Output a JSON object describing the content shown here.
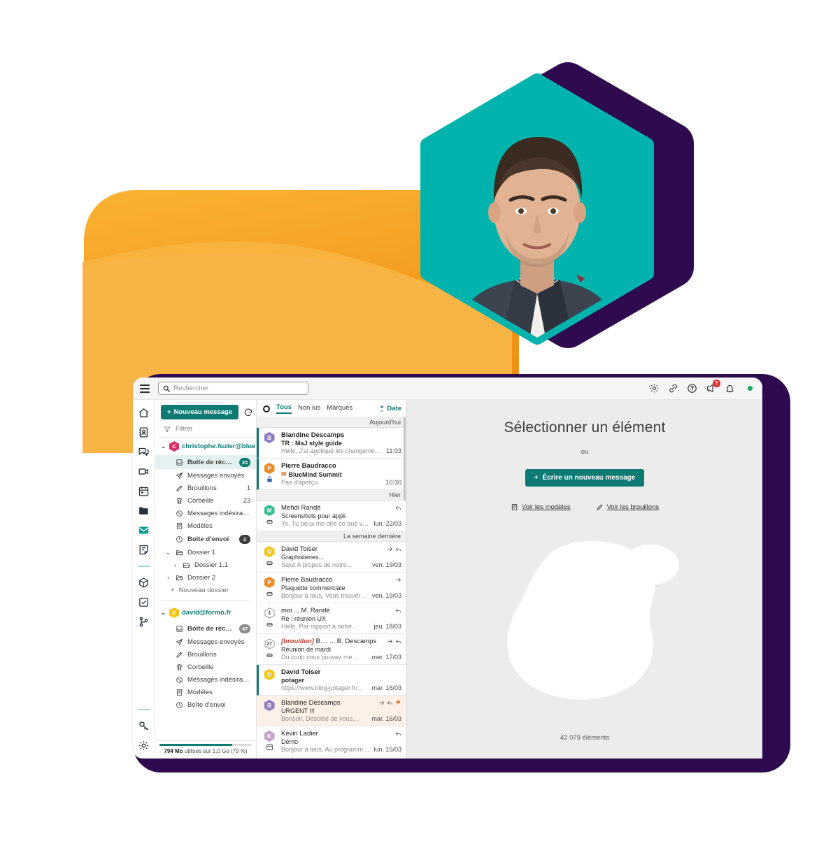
{
  "window": {
    "search": {
      "placeholder": "Rechercher",
      "value": "",
      "icon": "search-icon"
    },
    "menu_icon": "hamburger-icon",
    "topbar_icons": [
      {
        "name": "gear-icon",
        "label": "Paramètres"
      },
      {
        "name": "link-icon",
        "label": "Liens"
      },
      {
        "name": "help-icon",
        "label": "Aide"
      },
      {
        "name": "announcement-icon",
        "label": "Annonces",
        "badge": "3"
      },
      {
        "name": "bell-icon",
        "label": "Notifications"
      }
    ],
    "status_dot_color": "#18a566"
  },
  "rail": {
    "items": [
      {
        "name": "home-icon",
        "label": "Accueil",
        "active": false
      },
      {
        "name": "contacts-icon",
        "label": "Contacts",
        "active": false
      },
      {
        "name": "chat-icon",
        "label": "Messagerie instantanée",
        "active": false
      },
      {
        "name": "video-icon",
        "label": "Visioconférence",
        "active": false
      },
      {
        "name": "calendar-icon",
        "label": "Agenda",
        "active": false
      },
      {
        "name": "folder-icon",
        "label": "Fichiers",
        "active": false
      },
      {
        "name": "mail-icon",
        "label": "Courrier",
        "active": true
      },
      {
        "name": "notes-icon",
        "label": "Notes",
        "active": false
      },
      {
        "name": "cube-icon",
        "label": "Applications",
        "active": false
      },
      {
        "name": "tasks-icon",
        "label": "Tâches",
        "active": false
      },
      {
        "name": "workflow-icon",
        "label": "Workflow",
        "active": false
      }
    ],
    "bottom": [
      {
        "name": "key-icon",
        "label": "Clés"
      },
      {
        "name": "settings-icon",
        "label": "Réglages"
      }
    ]
  },
  "sidebar": {
    "new_message_label": "Nouveau message",
    "refresh_icon": "refresh-icon",
    "filter_label": "Filtrer",
    "filter_icon": "filter-icon",
    "accounts": [
      {
        "email": "christophe.fuzier@blue...",
        "initial": "C",
        "color": "#d6336c",
        "expanded": true,
        "folders": [
          {
            "label": "Boîte de réception",
            "icon": "inbox-icon",
            "count": "23",
            "badge_style": "teal",
            "selected": true,
            "bold": true,
            "depth": 1
          },
          {
            "label": "Messages envoyés",
            "icon": "sent-icon",
            "count": "",
            "badge_style": "",
            "selected": false,
            "bold": false,
            "depth": 1
          },
          {
            "label": "Brouillons",
            "icon": "draft-icon",
            "count": "1",
            "badge_style": "plain",
            "selected": false,
            "bold": false,
            "depth": 1
          },
          {
            "label": "Corbeille",
            "icon": "trash-icon",
            "count": "23",
            "badge_style": "plain",
            "selected": false,
            "bold": false,
            "depth": 1
          },
          {
            "label": "Messages indésirables",
            "icon": "spam-icon",
            "count": "",
            "badge_style": "",
            "selected": false,
            "bold": false,
            "depth": 1
          },
          {
            "label": "Modèles",
            "icon": "template-icon",
            "count": "",
            "badge_style": "",
            "selected": false,
            "bold": false,
            "depth": 1
          },
          {
            "label": "Boîte d'envoi",
            "icon": "outbox-icon",
            "count": "2",
            "badge_style": "dark",
            "selected": false,
            "bold": true,
            "depth": 1
          },
          {
            "label": "Dossier 1",
            "icon": "folder-open-icon",
            "count": "",
            "badge_style": "",
            "selected": false,
            "bold": false,
            "depth": 1,
            "caret": "down"
          },
          {
            "label": "Dossier 1.1",
            "icon": "folder-open-icon",
            "count": "",
            "badge_style": "",
            "selected": false,
            "bold": false,
            "depth": 2,
            "caret": "right"
          },
          {
            "label": "Dossier 2",
            "icon": "folder-open-icon",
            "count": "",
            "badge_style": "",
            "selected": false,
            "bold": false,
            "depth": 1,
            "caret": "right"
          }
        ],
        "new_folder_label": "Nouveau dossier"
      },
      {
        "email": "david@formo.fr",
        "initial": "D",
        "color": "#f5c518",
        "expanded": true,
        "folders": [
          {
            "label": "Boîte de réception",
            "icon": "inbox-icon",
            "count": "47",
            "badge_style": "grey",
            "selected": false,
            "bold": true,
            "depth": 1
          },
          {
            "label": "Messages envoyés",
            "icon": "sent-icon",
            "count": "",
            "badge_style": "",
            "selected": false,
            "bold": false,
            "depth": 1
          },
          {
            "label": "Brouillons",
            "icon": "draft-icon",
            "count": "",
            "badge_style": "",
            "selected": false,
            "bold": false,
            "depth": 1
          },
          {
            "label": "Corbeille",
            "icon": "trash-icon",
            "count": "",
            "badge_style": "",
            "selected": false,
            "bold": false,
            "depth": 1
          },
          {
            "label": "Messages indésirables",
            "icon": "spam-icon",
            "count": "",
            "badge_style": "",
            "selected": false,
            "bold": false,
            "depth": 1
          },
          {
            "label": "Modèles",
            "icon": "template-icon",
            "count": "",
            "badge_style": "",
            "selected": false,
            "bold": false,
            "depth": 1
          },
          {
            "label": "Boîte d'envoi",
            "icon": "outbox-icon",
            "count": "",
            "badge_style": "",
            "selected": false,
            "bold": false,
            "depth": 1
          }
        ],
        "new_folder_label": ""
      }
    ],
    "quota": {
      "used": "794 Mo",
      "text": " utilisés sur 1.0 Go (79 %)",
      "percent": 79
    }
  },
  "message_list": {
    "select_all_icon": "select-circle-icon",
    "tabs": [
      {
        "label": "Tous",
        "active": true
      },
      {
        "label": "Non lus",
        "active": false
      },
      {
        "label": "Marqués",
        "active": false
      }
    ],
    "sort": {
      "label": "Date",
      "icon": "sort-icon"
    },
    "groups": [
      {
        "label": "Aujourd'hui",
        "messages": [
          {
            "from": "Blandine Descamps",
            "initial": "B",
            "color": "#8e7cc3",
            "subject": "TR : MaJ style guide",
            "preview": "Hello, J'ai appliqué les changements...",
            "date": "11:03",
            "unread": true,
            "flagged": false,
            "icons": [],
            "sub_icon": "",
            "subject_prefix": ""
          },
          {
            "from": "Pierre Baudracco",
            "initial": "P",
            "color": "#f08a24",
            "subject": "BlueMind Summit",
            "preview": "Pas d'aperçu",
            "date": "10:30",
            "unread": true,
            "flagged": false,
            "icons": [],
            "sub_icon": "lock-icon",
            "subject_prefix": "event-icon"
          }
        ]
      },
      {
        "label": "Hier",
        "messages": [
          {
            "from": "Mehdi Randé",
            "initial": "M",
            "color": "#2fbf8f",
            "subject": "Screenshots pour appli",
            "preview": "Yo, Tu peux me dire ce que vo...",
            "date": "lun. 22/03",
            "unread": false,
            "flagged": false,
            "icons": [
              "reply-icon"
            ],
            "sub_icon": "attach-icon",
            "subject_prefix": ""
          }
        ]
      },
      {
        "label": "La semaine dernière",
        "messages": [
          {
            "from": "David Toiser",
            "initial": "D",
            "color": "#f5c518",
            "subject": "Graphisteries...",
            "preview": "Salut A propos de notre...",
            "date": "ven. 19/03",
            "unread": false,
            "flagged": false,
            "icons": [
              "forward-icon",
              "reply-icon"
            ],
            "sub_icon": "attach-icon",
            "subject_prefix": ""
          },
          {
            "from": "Pierre Baudracco",
            "initial": "P",
            "color": "#f08a24",
            "subject": "Plaquette commerciale",
            "preview": "Bonjour à tous, Vous trouverez...",
            "date": "ven. 19/03",
            "unread": false,
            "flagged": false,
            "icons": [
              "forward-icon"
            ],
            "sub_icon": "attach-icon",
            "subject_prefix": ""
          },
          {
            "from": "moi ... M. Randé",
            "initial": "3",
            "color": "",
            "subject": "Re : réunion UX",
            "preview": "Hello, Par rapport à notre...",
            "date": "jeu. 18/03",
            "unread": false,
            "flagged": false,
            "icons": [
              "reply-icon"
            ],
            "sub_icon": "attach-icon",
            "subject_prefix": "",
            "thread_count": "3"
          },
          {
            "from": "B.... ... B. Descamps",
            "initial": "27",
            "color": "",
            "subject": "Réunion de mardi",
            "preview": "Du coup vous pouvez me...",
            "date": "mer. 17/03",
            "unread": false,
            "flagged": false,
            "icons": [
              "forward-icon",
              "reply-icon"
            ],
            "sub_icon": "attach-icon",
            "subject_prefix": "",
            "thread_count": "27",
            "draft_label": "[brouillon]"
          },
          {
            "from": "David Toiser",
            "initial": "D",
            "color": "#f5c518",
            "subject": "potager",
            "preview": "https://www.blog-potager.fr/...",
            "date": "mar. 16/03",
            "unread": true,
            "flagged": false,
            "icons": [],
            "sub_icon": "",
            "subject_prefix": ""
          },
          {
            "from": "Blandine Descamps",
            "initial": "B",
            "color": "#8e7cc3",
            "subject": "URGENT !!!",
            "preview": "Bonsoir, Désolée de vous...",
            "date": "mar. 16/03",
            "unread": false,
            "flagged": true,
            "icons": [
              "forward-icon",
              "reply-icon",
              "flag-icon"
            ],
            "sub_icon": "",
            "subject_prefix": ""
          },
          {
            "from": "Kévin Ladier",
            "initial": "K",
            "color": "#c9a0c9",
            "subject": "Démo",
            "preview": "Bonjour à tous, Au programme...",
            "date": "lun. 15/03",
            "unread": false,
            "flagged": false,
            "icons": [
              "reply-icon"
            ],
            "sub_icon": "calendar-small-icon",
            "subject_prefix": ""
          }
        ]
      }
    ],
    "tag_colors": [
      "#7b8fd4",
      "#f5c518",
      "#3faa6a",
      "#a884c9",
      "#3fc8e8"
    ]
  },
  "reader": {
    "title": "Sélectionner un élément",
    "or_label": "ou",
    "write_button": "Écrire un nouveau message",
    "links": [
      {
        "label": "Voir les modèles",
        "icon": "template-icon"
      },
      {
        "label": "Voir les brouillons",
        "icon": "pencil-icon"
      }
    ],
    "item_count": "42 079 éléments"
  },
  "colors": {
    "brand_teal": "#0d7a74",
    "accent_orange": "#f5a623",
    "deep_purple": "#2e0a4f",
    "hex_teal": "#00b3ac"
  }
}
